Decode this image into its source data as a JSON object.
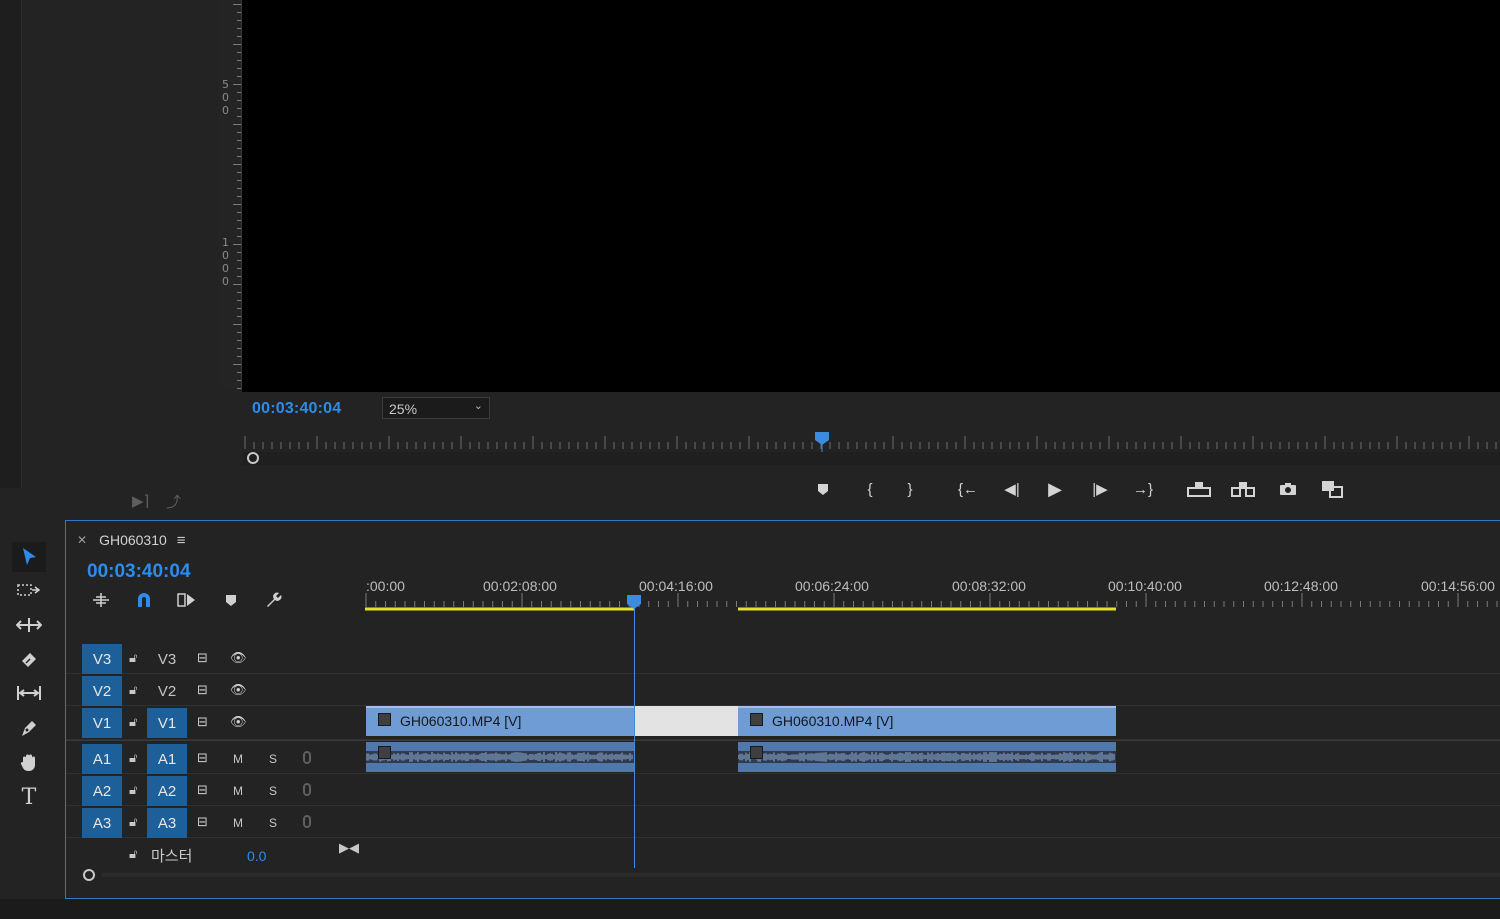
{
  "monitor": {
    "timecode": "00:03:40:04",
    "zoom": "25%",
    "ruler_numbers": [
      [
        "5",
        "0",
        "0"
      ],
      [
        "1",
        "0",
        "0",
        "0"
      ]
    ]
  },
  "transport": {
    "buttons": [
      "add-marker",
      "mark-in",
      "mark-out",
      "go-to-in",
      "step-back",
      "play",
      "step-forward",
      "go-to-out",
      "lift",
      "extract",
      "export-frame",
      "comparison-view"
    ]
  },
  "sequence": {
    "name": "GH060310",
    "timecode": "00:03:40:04",
    "ruler_labels": [
      ":00:00",
      "00:02:08:00",
      "00:04:16:00",
      "00:06:24:00",
      "00:08:32:00",
      "00:10:40:00",
      "00:12:48:00",
      "00:14:56:00"
    ],
    "master_label": "마스터",
    "master_value": "0.0"
  },
  "tracks": {
    "video": [
      {
        "source": "V3",
        "target": "V3"
      },
      {
        "source": "V2",
        "target": "V2"
      },
      {
        "source": "V1",
        "target": "V1"
      }
    ],
    "audio": [
      {
        "source": "A1",
        "target": "A1",
        "m": "M",
        "s": "S"
      },
      {
        "source": "A2",
        "target": "A2",
        "m": "M",
        "s": "S"
      },
      {
        "source": "A3",
        "target": "A3",
        "m": "M",
        "s": "S"
      }
    ]
  },
  "clips": {
    "v1_first": "GH060310.MP4 [V]",
    "v1_second": "GH060310.MP4 [V]"
  },
  "colors": {
    "accent": "#2d8ceb",
    "video_clip": "#6f9cd4",
    "audio_clip": "#5078ad",
    "track_target_on": "#1d5f98",
    "work_area": "#e5e02c"
  }
}
